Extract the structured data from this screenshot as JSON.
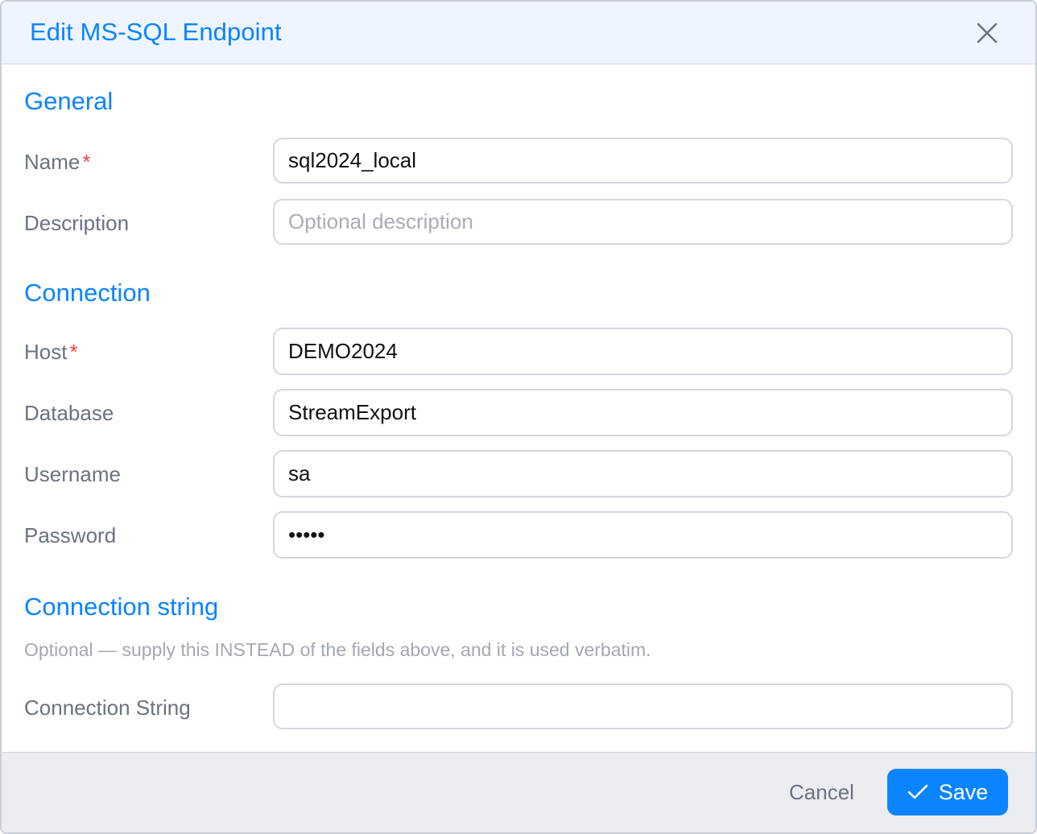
{
  "dialog": {
    "title": "Edit MS-SQL Endpoint",
    "close_icon": "close-icon"
  },
  "sections": {
    "general": "General",
    "connection": "Connection",
    "connection_string": "Connection string"
  },
  "fields": {
    "name": {
      "label": "Name",
      "required_mark": "*",
      "value": "sql2024_local"
    },
    "description": {
      "label": "Description",
      "value": "",
      "placeholder": "Optional description"
    },
    "host": {
      "label": "Host",
      "required_mark": "*",
      "value": "DEMO2024"
    },
    "database": {
      "label": "Database",
      "value": "StreamExport"
    },
    "username": {
      "label": "Username",
      "value": "sa"
    },
    "password": {
      "label": "Password",
      "value": "•••••"
    },
    "connection_string": {
      "label": "Connection String",
      "value": ""
    }
  },
  "connection_string_help": "Optional — supply this INSTEAD of the fields above, and it is used verbatim.",
  "footer": {
    "cancel_label": "Cancel",
    "save_label": "Save",
    "save_icon": "check-icon"
  },
  "colors": {
    "accent": "#0a84ff",
    "required": "#ef4444",
    "header_bg": "#eef5ff",
    "footer_bg": "#ebedf1"
  }
}
